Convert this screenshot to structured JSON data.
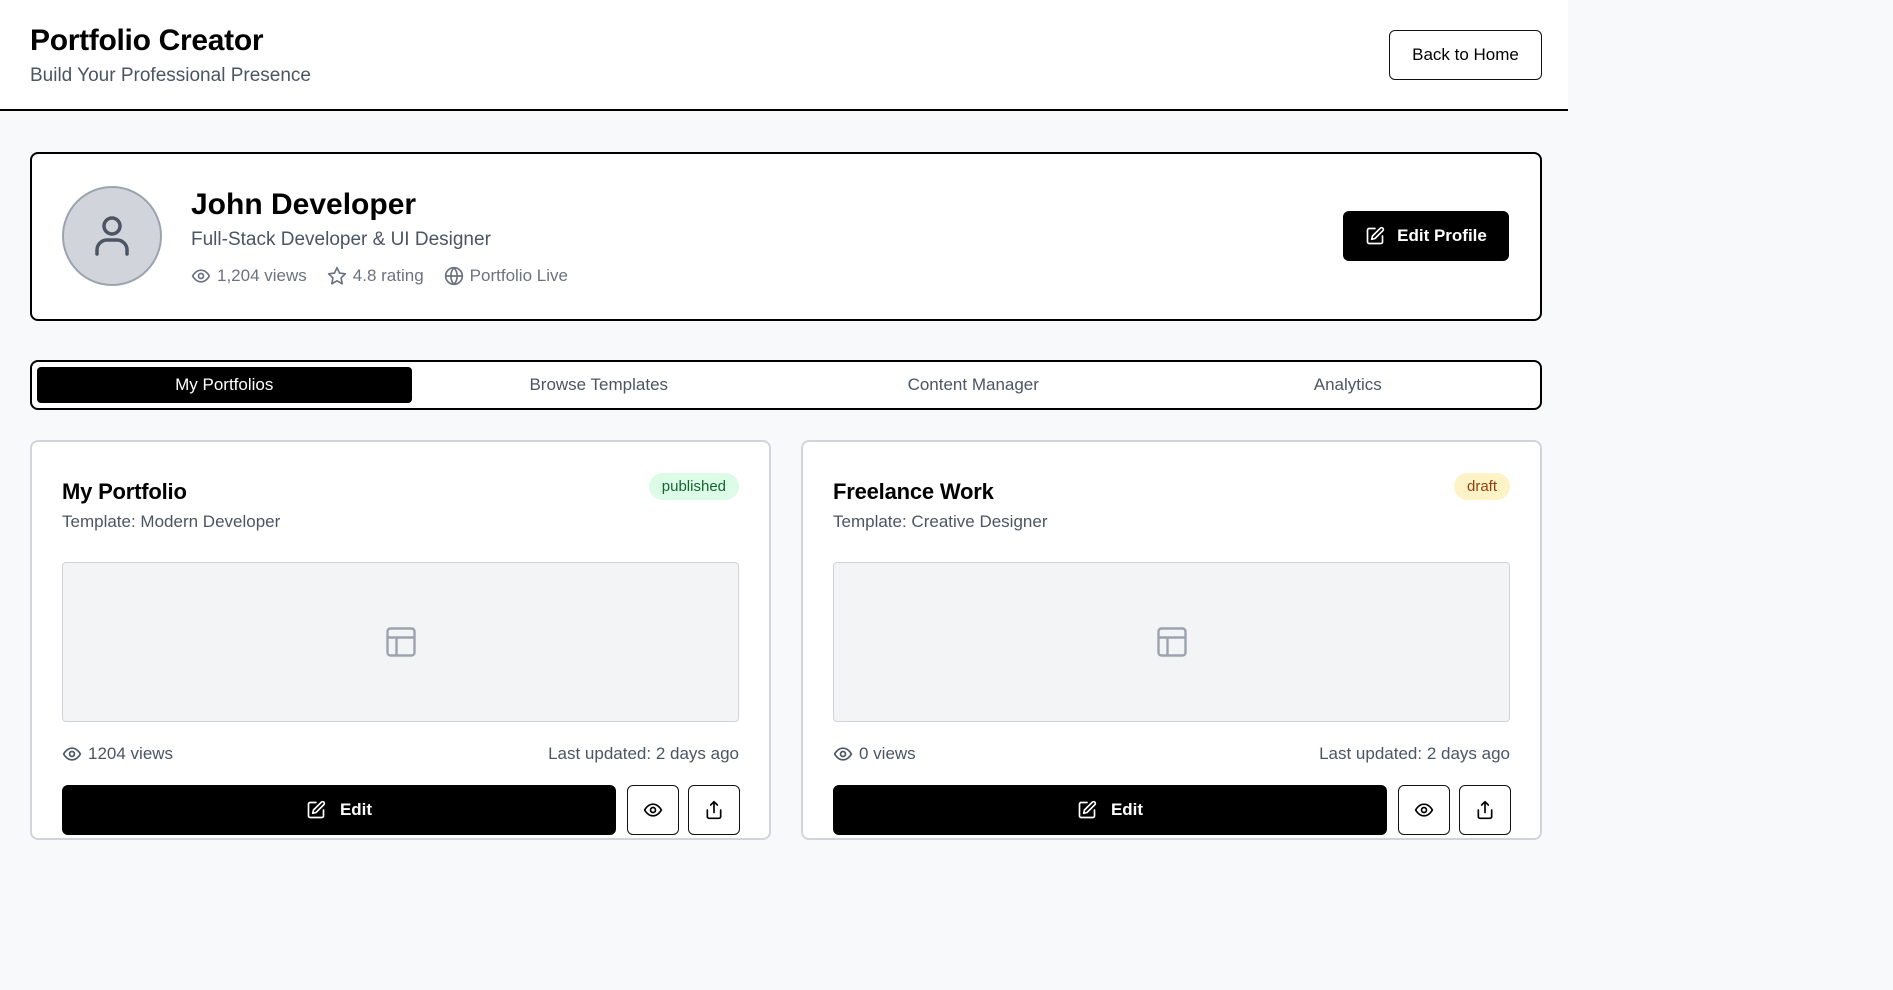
{
  "header": {
    "title": "Portfolio Creator",
    "subtitle": "Build Your Professional Presence",
    "back_label": "Back to Home"
  },
  "profile": {
    "name": "John Developer",
    "role": "Full-Stack Developer & UI Designer",
    "views": "1,204 views",
    "rating": "4.8 rating",
    "status": "Portfolio Live",
    "edit_label": "Edit Profile"
  },
  "tabs": [
    {
      "label": "My Portfolios",
      "active": true
    },
    {
      "label": "Browse Templates",
      "active": false
    },
    {
      "label": "Content Manager",
      "active": false
    },
    {
      "label": "Analytics",
      "active": false
    }
  ],
  "portfolios": [
    {
      "title": "My Portfolio",
      "template": "Template: Modern Developer",
      "status": "published",
      "views": "1204 views",
      "updated": "Last updated: 2 days ago",
      "edit_label": "Edit"
    },
    {
      "title": "Freelance Work",
      "template": "Template: Creative Designer",
      "status": "draft",
      "views": "0 views",
      "updated": "Last updated: 2 days ago",
      "edit_label": "Edit"
    }
  ],
  "colors": {
    "primary": "#000000",
    "published_bg": "#dcfce7",
    "published_text": "#166534",
    "draft_bg": "#fef3c7",
    "draft_text": "#92400e"
  }
}
